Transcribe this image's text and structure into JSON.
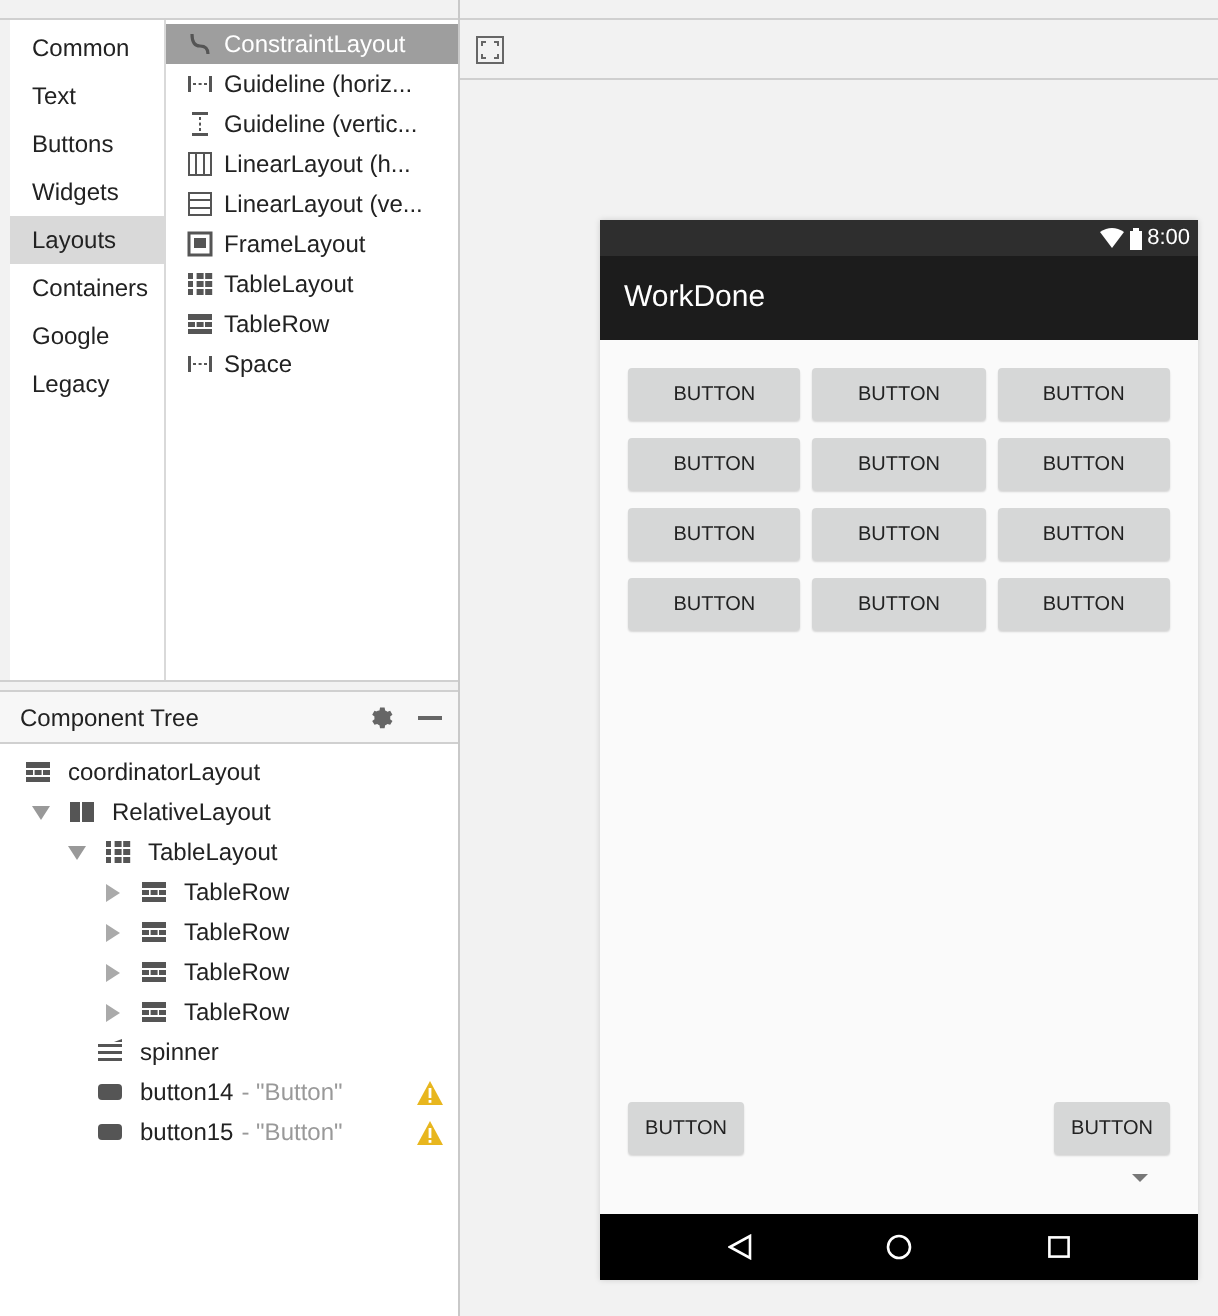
{
  "palette": {
    "categories": [
      {
        "label": "Common",
        "selected": false
      },
      {
        "label": "Text",
        "selected": false
      },
      {
        "label": "Buttons",
        "selected": false
      },
      {
        "label": "Widgets",
        "selected": false
      },
      {
        "label": "Layouts",
        "selected": true
      },
      {
        "label": "Containers",
        "selected": false
      },
      {
        "label": "Google",
        "selected": false
      },
      {
        "label": "Legacy",
        "selected": false
      }
    ],
    "items": [
      {
        "label": "ConstraintLayout",
        "kind": "constraint",
        "selected": true
      },
      {
        "label": "Guideline (horiz...",
        "kind": "hguide",
        "selected": false
      },
      {
        "label": "Guideline (vertic...",
        "kind": "vguide",
        "selected": false
      },
      {
        "label": "LinearLayout (h...",
        "kind": "hlinear",
        "selected": false
      },
      {
        "label": "LinearLayout (ve...",
        "kind": "vlinear",
        "selected": false
      },
      {
        "label": "FrameLayout",
        "kind": "frame",
        "selected": false
      },
      {
        "label": "TableLayout",
        "kind": "table",
        "selected": false
      },
      {
        "label": "TableRow",
        "kind": "tablerow",
        "selected": false
      },
      {
        "label": "Space",
        "kind": "hguide",
        "selected": false
      }
    ]
  },
  "component_tree": {
    "title": "Component Tree",
    "nodes": [
      {
        "label": "coordinatorLayout",
        "kind": "tablerow",
        "children": [
          {
            "label": "RelativeLayout",
            "kind": "relative",
            "expanded": true,
            "children": [
              {
                "label": "TableLayout",
                "kind": "table",
                "expanded": true,
                "children": [
                  {
                    "label": "TableRow",
                    "kind": "tablerow",
                    "expanded": false
                  },
                  {
                    "label": "TableRow",
                    "kind": "tablerow",
                    "expanded": false
                  },
                  {
                    "label": "TableRow",
                    "kind": "tablerow",
                    "expanded": false
                  },
                  {
                    "label": "TableRow",
                    "kind": "tablerow",
                    "expanded": false
                  }
                ]
              },
              {
                "label": "spinner",
                "kind": "spinner"
              },
              {
                "label": "button14",
                "hint": "- \"Button\"",
                "kind": "button",
                "warning": true
              },
              {
                "label": "button15",
                "hint": "- \"Button\"",
                "kind": "button",
                "warning": true
              }
            ]
          }
        ]
      }
    ]
  },
  "device": {
    "time": "8:00",
    "app_title": "WorkDone",
    "grid": [
      [
        "BUTTON",
        "BUTTON",
        "BUTTON"
      ],
      [
        "BUTTON",
        "BUTTON",
        "BUTTON"
      ],
      [
        "BUTTON",
        "BUTTON",
        "BUTTON"
      ],
      [
        "BUTTON",
        "BUTTON",
        "BUTTON"
      ]
    ],
    "bottom_buttons": [
      "BUTTON",
      "BUTTON"
    ]
  }
}
